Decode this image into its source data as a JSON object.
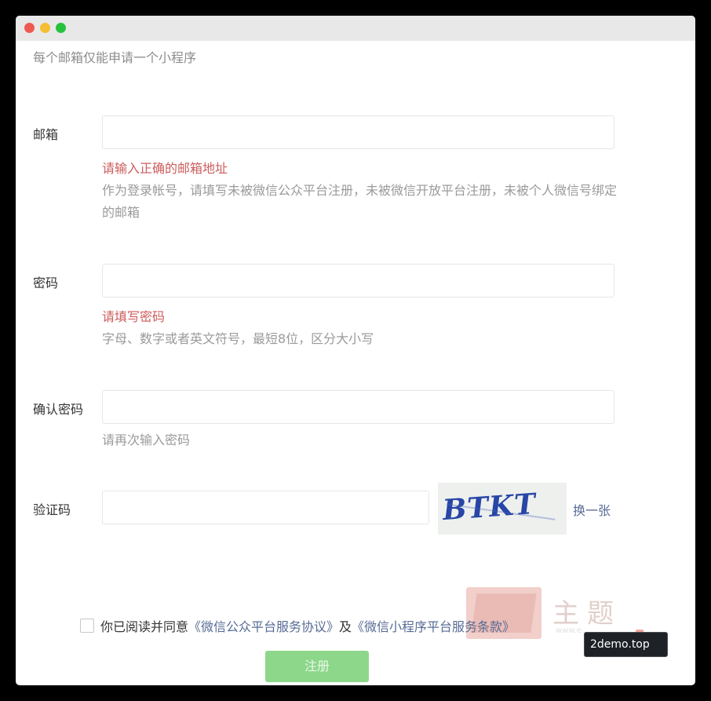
{
  "window": {
    "controls": [
      "close",
      "minimize",
      "maximize"
    ]
  },
  "form": {
    "subtitle": "每个邮箱仅能申请一个小程序",
    "email": {
      "label": "邮箱",
      "value": "",
      "error": "请输入正确的邮箱地址",
      "tip": "作为登录帐号，请填写未被微信公众平台注册，未被微信开放平台注册，未被个人微信号绑定的邮箱"
    },
    "password": {
      "label": "密码",
      "value": "",
      "error": "请填写密码",
      "tip": "字母、数字或者英文符号，最短8位，区分大小写"
    },
    "confirm": {
      "label": "确认密码",
      "value": "",
      "tip": "请再次输入密码"
    },
    "captcha": {
      "label": "验证码",
      "value": "",
      "image_text": "BTKT",
      "refresh": "换一张"
    },
    "agreement": {
      "prefix": "你已阅读并同意",
      "link1": "《微信公众平台服务协议》",
      "middle": "及",
      "link2": "《微信小程序平台服务条款》",
      "checked": false
    },
    "submit_label": "注册"
  },
  "watermark": {
    "chars": "主题",
    "small": "www.e...",
    "badge": "2demo.top"
  },
  "colors": {
    "error": "#cd5c5c",
    "link": "#576b95",
    "submit_disabled": "#8dd78b",
    "hint": "#9a9a9a"
  }
}
